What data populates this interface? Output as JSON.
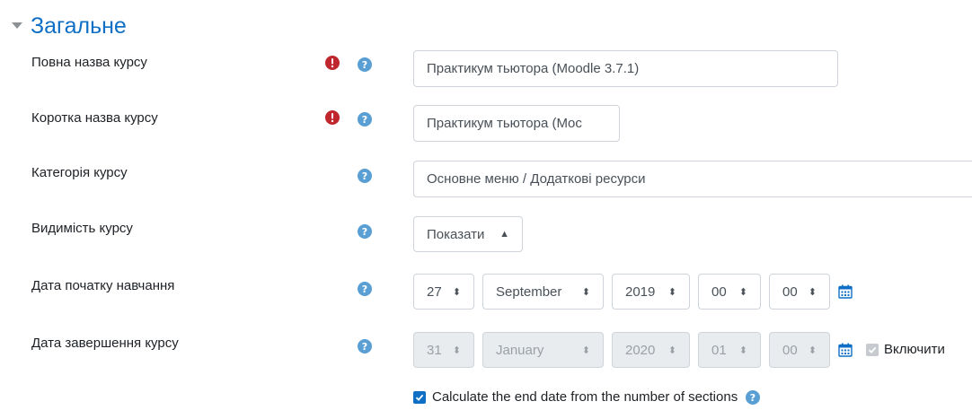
{
  "section": {
    "title": "Загальне"
  },
  "fields": {
    "fullname": {
      "label": "Повна назва курсу",
      "value": "Практикум тьютора (Moodle 3.7.1)"
    },
    "shortname": {
      "label": "Коротка назва курсу",
      "value": "Практикум тьютора (Moс"
    },
    "category": {
      "label": "Категорія курсу",
      "value": "Основне меню / Додаткові ресурси"
    },
    "visibility": {
      "label": "Видимість курсу",
      "value": "Показати"
    },
    "startdate": {
      "label": "Дата початку навчання",
      "day": "27",
      "month": "September",
      "year": "2019",
      "hour": "00",
      "minute": "00"
    },
    "enddate": {
      "label": "Дата завершення курсу",
      "day": "31",
      "month": "January",
      "year": "2020",
      "hour": "01",
      "minute": "00",
      "enable_label": "Включити"
    },
    "calc_enddate": {
      "label": "Calculate the end date from the number of sections"
    }
  },
  "colors": {
    "accent": "#0f6fc5",
    "required": "#c0262d",
    "help": "#5a9fd4"
  },
  "icons": {
    "collapse": "triangle-down-icon",
    "required": "exclamation-circle-icon",
    "help": "question-circle-icon",
    "calendar": "calendar-icon",
    "check": "check-icon"
  }
}
